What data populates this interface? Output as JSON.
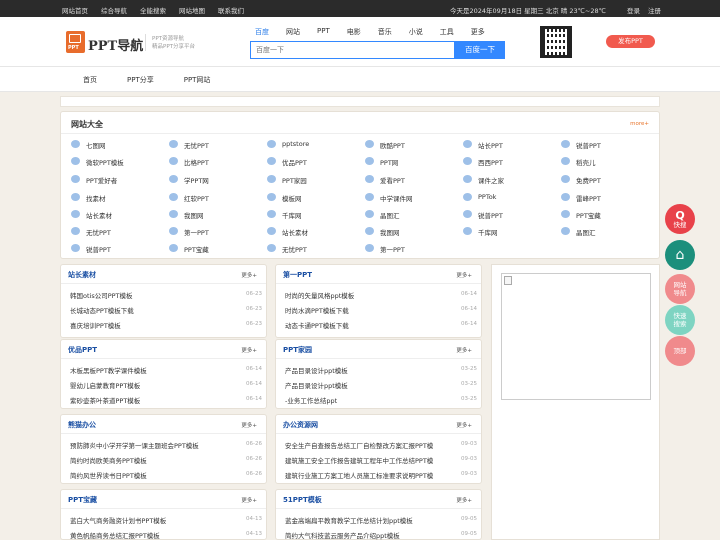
{
  "topbar": {
    "links": [
      "网站首页",
      "综合导航",
      "全能搜索",
      "网站地图",
      "联系我们"
    ],
    "date": "今天是2024年09月18日 星期三 北京 晴 23℃~28℃",
    "login": "登录",
    "register": "注册"
  },
  "header": {
    "logo_text": "PPT导航",
    "logo_badge": "PPT",
    "logo_sub1": "PPT资源导航",
    "logo_sub2": "精品PPT分享平台",
    "search_tabs": [
      "百度",
      "网站",
      "PPT",
      "电影",
      "音乐",
      "小说",
      "工具",
      "更多"
    ],
    "search_placeholder": "百度一下",
    "search_button": "百度一下",
    "post_button": "发布PPT"
  },
  "nav": {
    "items": [
      "首页",
      "PPT分享",
      "PPT网站"
    ]
  },
  "sites": {
    "title": "网站大全",
    "more": "more+",
    "rows": [
      [
        "七图网",
        "无忧PPT",
        "pptstore",
        "欧酷PPT",
        "站长PPT",
        "锐普PPT"
      ],
      [
        "微软PPT模板",
        "比格PPT",
        "优品PPT",
        "PPT网",
        "西西PPT",
        "稻壳儿"
      ],
      [
        "PPT爱好者",
        "学PPT网",
        "PPT家园",
        "爱看PPT",
        "课件之家",
        "免费PPT"
      ],
      [
        "找素材",
        "红软PPT",
        "模板网",
        "中学课件网",
        "PPTok",
        "雷峰PPT"
      ],
      [
        "站长素材",
        "我图网",
        "千库网",
        "晶图汇",
        "锐普PPT",
        "PPT宝藏"
      ],
      [
        "无忧PPT",
        "第一PPT",
        "站长素材",
        "我图网",
        "千库网",
        "晶图汇"
      ],
      [
        "锐普PPT",
        "PPT宝藏",
        "无忧PPT",
        "第一PPT"
      ]
    ]
  },
  "panels": [
    {
      "title": "站长素材",
      "more": "更多+",
      "items": [
        {
          "t": "韩国otis公司PPT模板",
          "d": "06-23"
        },
        {
          "t": "长城动态PPT模板下载",
          "d": "06-23"
        },
        {
          "t": "喜庆培训PPT模板",
          "d": "06-23"
        }
      ]
    },
    {
      "title": "第一PPT",
      "more": "更多+",
      "items": [
        {
          "t": "时尚的矢量风格ppt模板",
          "d": "06-14"
        },
        {
          "t": "时尚水滴PPT模板下载",
          "d": "06-14"
        },
        {
          "t": "动态卡通PPT模板下载",
          "d": "06-14"
        }
      ]
    },
    {
      "title": "优品PPT",
      "more": "更多+",
      "items": [
        {
          "t": "木板黑板PPT教学课件模板",
          "d": "06-14"
        },
        {
          "t": "婴幼儿启蒙教育PPT模板",
          "d": "06-14"
        },
        {
          "t": "紫砂壶茶叶茶道PPT模板",
          "d": "06-14"
        }
      ]
    },
    {
      "title": "PPT家园",
      "more": "更多+",
      "items": [
        {
          "t": "产品目录设计ppt模板",
          "d": "03-25"
        },
        {
          "t": "产品目录设计ppt模板",
          "d": "03-25"
        },
        {
          "t": "-业务工作总结ppt",
          "d": "03-25"
        }
      ]
    },
    {
      "title": "熊猫办公",
      "more": "更多+",
      "items": [
        {
          "t": "预防肺炎中小学开学第一课主题班会PPT模板",
          "d": "06-26"
        },
        {
          "t": "简约时尚欧美商务PPT模板",
          "d": "06-26"
        },
        {
          "t": "简约风世界读书日PPT模板",
          "d": "06-26"
        }
      ]
    },
    {
      "title": "办公资源网",
      "more": "更多+",
      "items": [
        {
          "t": "安全生产自查报告总结工厂自检整改方案汇报PPT模",
          "d": "09-03"
        },
        {
          "t": "建筑施工安全工作报告建筑工程年中工作总结PPT模",
          "d": "09-03"
        },
        {
          "t": "建筑行业施工方案工地人员施工标准要求说明PPT模",
          "d": "09-03"
        }
      ]
    },
    {
      "title": "PPT宝藏",
      "more": "更多+",
      "items": [
        {
          "t": "蓝白大气商务融资计划书PPT模板",
          "d": "04-13"
        },
        {
          "t": "黄色帆船商务总结汇报PPT模板",
          "d": "04-13"
        }
      ]
    },
    {
      "title": "51PPT模板",
      "more": "更多+",
      "items": [
        {
          "t": "蓝金高端扁平教育教学工作总结计划ppt模板",
          "d": "09-05"
        },
        {
          "t": "简约大气科技蓝云服务产品介绍ppt模板",
          "d": "09-05"
        }
      ]
    }
  ],
  "float_buttons": [
    {
      "label": "快搜",
      "color": "#e8424a"
    },
    {
      "label": "",
      "color": "#1c8f7c"
    },
    {
      "label": "网站导航",
      "color": "#f08a8c"
    },
    {
      "label": "快速搜索",
      "color": "#7ed4c2"
    },
    {
      "label": "顶部",
      "color": "#f08a8c"
    }
  ]
}
